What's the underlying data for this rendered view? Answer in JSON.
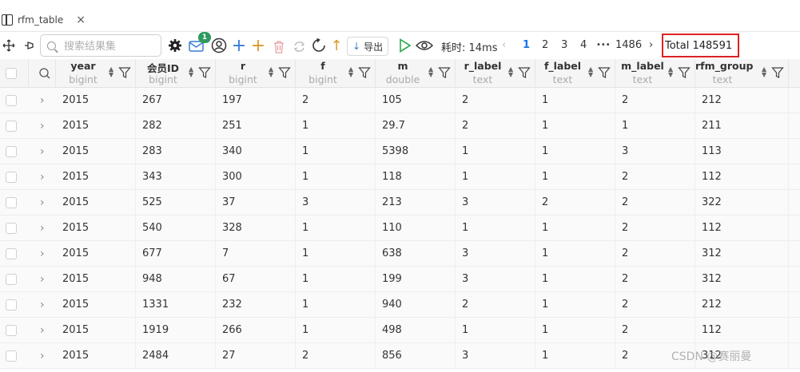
{
  "tab": {
    "title": "rfm_table",
    "close": "×"
  },
  "toolbar": {
    "search_placeholder": "搜索结果集",
    "notification_count": "1",
    "export_label": "导出",
    "timing": "耗时: 14ms",
    "pages": [
      "1",
      "2",
      "3",
      "4",
      "•••",
      "1486"
    ],
    "total": "Total 148591"
  },
  "columns": [
    {
      "name": "year",
      "type": "bigint"
    },
    {
      "name": "会员ID",
      "type": "bigint"
    },
    {
      "name": "r",
      "type": "bigint"
    },
    {
      "name": "f",
      "type": "bigint"
    },
    {
      "name": "m",
      "type": "double"
    },
    {
      "name": "r_label",
      "type": "text"
    },
    {
      "name": "f_label",
      "type": "text"
    },
    {
      "name": "m_label",
      "type": "text"
    },
    {
      "name": "rfm_group",
      "type": "text"
    }
  ],
  "rows": [
    [
      "2015",
      "267",
      "197",
      "2",
      "105",
      "2",
      "1",
      "2",
      "212"
    ],
    [
      "2015",
      "282",
      "251",
      "1",
      "29.7",
      "2",
      "1",
      "1",
      "211"
    ],
    [
      "2015",
      "283",
      "340",
      "1",
      "5398",
      "1",
      "1",
      "3",
      "113"
    ],
    [
      "2015",
      "343",
      "300",
      "1",
      "118",
      "1",
      "1",
      "2",
      "112"
    ],
    [
      "2015",
      "525",
      "37",
      "3",
      "213",
      "3",
      "2",
      "2",
      "322"
    ],
    [
      "2015",
      "540",
      "328",
      "1",
      "110",
      "1",
      "1",
      "2",
      "112"
    ],
    [
      "2015",
      "677",
      "7",
      "1",
      "638",
      "3",
      "1",
      "2",
      "312"
    ],
    [
      "2015",
      "948",
      "67",
      "1",
      "199",
      "3",
      "1",
      "2",
      "312"
    ],
    [
      "2015",
      "1331",
      "232",
      "1",
      "940",
      "2",
      "1",
      "2",
      "212"
    ],
    [
      "2015",
      "1919",
      "266",
      "1",
      "498",
      "1",
      "1",
      "2",
      "112"
    ],
    [
      "2015",
      "2484",
      "27",
      "2",
      "856",
      "3",
      "1",
      "2",
      "312"
    ]
  ],
  "watermark": "CSDN @赛丽曼",
  "colors": {
    "accent": "#1a73e8",
    "highlight_border": "#dd2222",
    "badge": "#2e9a5e",
    "play": "#2aa84a",
    "header_bg": "#f5f5f5"
  }
}
